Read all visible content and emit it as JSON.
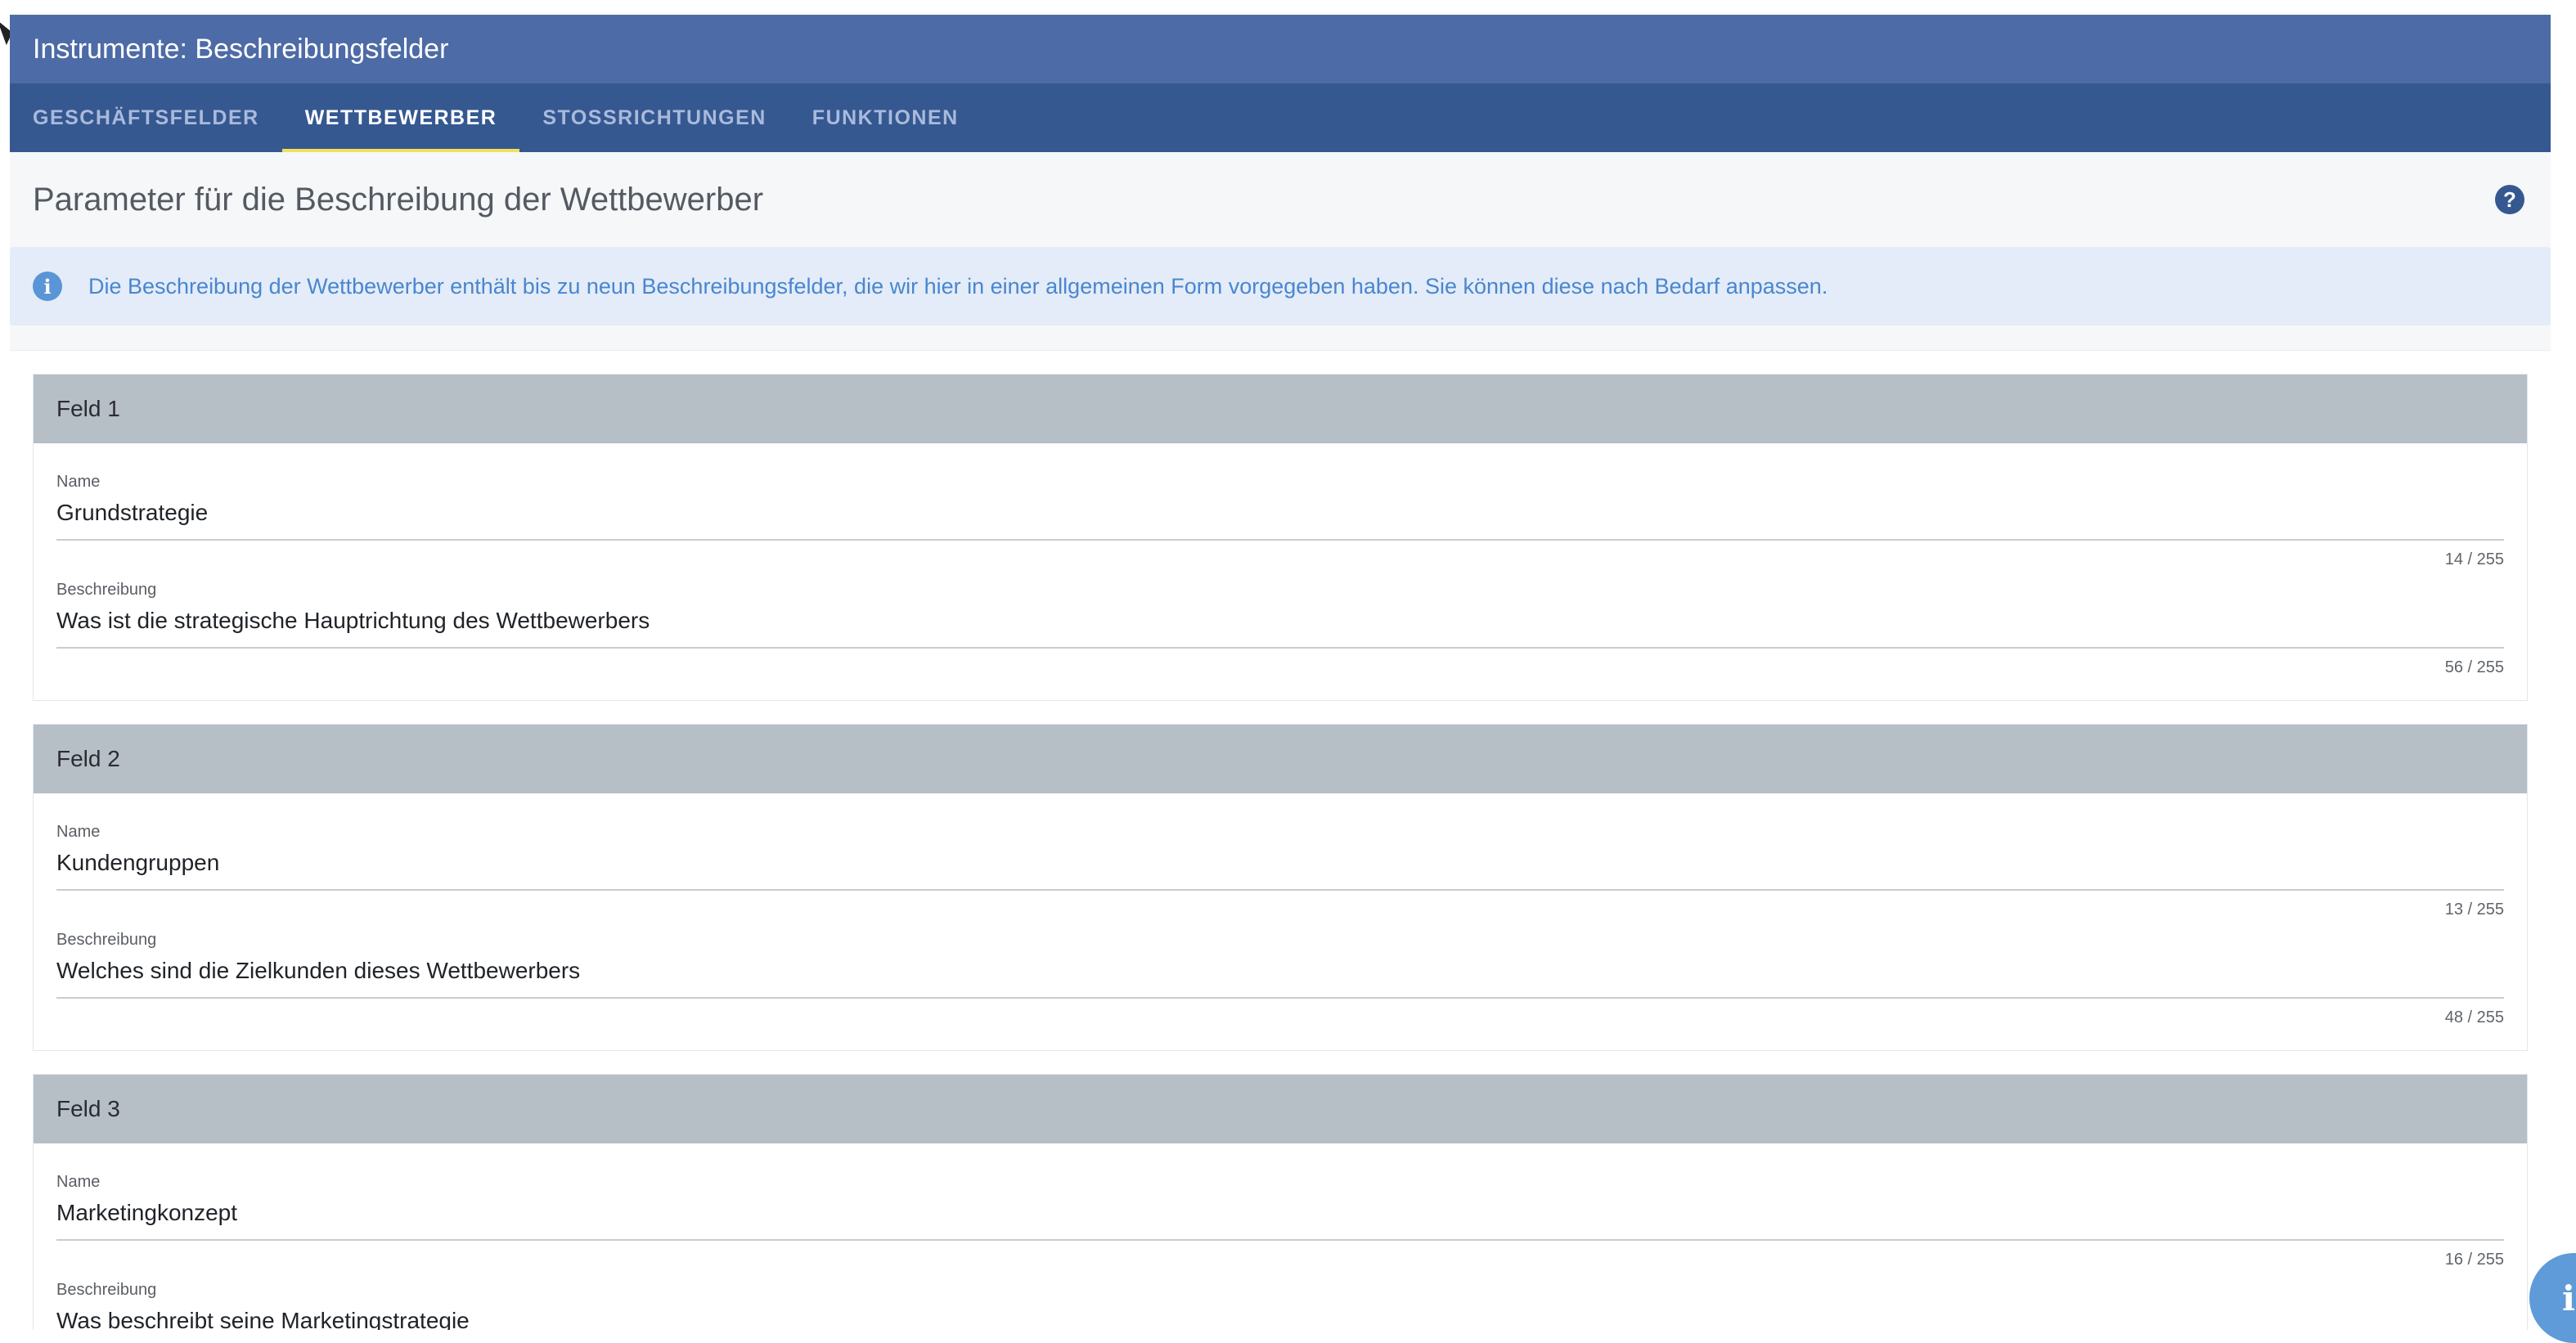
{
  "window": {
    "title": "Instrumente: Beschreibungsfelder"
  },
  "tabs": [
    {
      "label": "GESCHÄFTSFELDER",
      "active": false
    },
    {
      "label": "WETTBEWERBER",
      "active": true
    },
    {
      "label": "STOSSRICHTUNGEN",
      "active": false
    },
    {
      "label": "FUNKTIONEN",
      "active": false
    }
  ],
  "section": {
    "title": "Parameter für die Beschreibung der Wettbewerber",
    "help_icon": "question-circle-icon"
  },
  "info": {
    "icon": "info-circle-icon",
    "text": "Die Beschreibung der Wettbewerber enthält bis zu neun Beschreibungsfelder, die wir hier in einer allgemeinen Form vorgegeben haben. Sie können diese nach Bedarf anpassen."
  },
  "fields": [
    {
      "heading": "Feld 1",
      "name_label": "Name",
      "name_value": "Grundstrategie",
      "name_counter": "14 / 255",
      "desc_label": "Beschreibung",
      "desc_value": "Was ist die strategische Hauptrichtung des Wettbewerbers",
      "desc_counter": "56 / 255"
    },
    {
      "heading": "Feld 2",
      "name_label": "Name",
      "name_value": "Kundengruppen",
      "name_counter": "13 / 255",
      "desc_label": "Beschreibung",
      "desc_value": "Welches sind die Zielkunden dieses Wettbewerbers",
      "desc_counter": "48 / 255"
    },
    {
      "heading": "Feld 3",
      "name_label": "Name",
      "name_value": "Marketingkonzept",
      "name_counter": "16 / 255",
      "desc_label": "Beschreibung",
      "desc_value": "Was beschreibt seine Marketingstrategie",
      "desc_counter": ""
    }
  ],
  "colors": {
    "titlebar": "#4d6ba6",
    "tabbar": "#355891",
    "active_indicator": "#f0e15a",
    "info_bg": "#e3ecf8",
    "info_text": "#4a86cf",
    "field_header": "#b6bec6"
  }
}
